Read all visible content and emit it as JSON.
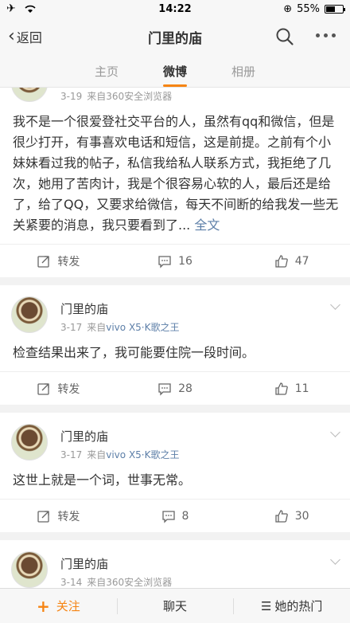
{
  "status_bar": {
    "time": "14:22",
    "battery_text": "55%",
    "battery_level": 0.55,
    "icons": [
      "airplane-icon",
      "wifi-icon",
      "lock-rotation-icon",
      "battery-icon"
    ]
  },
  "nav": {
    "back_label": "返回",
    "title": "门里的庙",
    "icons": [
      "search-icon",
      "more-icon"
    ]
  },
  "tabs": [
    {
      "label": "主页",
      "active": false
    },
    {
      "label": "微博",
      "active": true
    },
    {
      "label": "相册",
      "active": false
    }
  ],
  "accent_color": "#f68413",
  "link_color": "#5d7fa8",
  "posts": [
    {
      "author": "",
      "date": "3-19",
      "source_prefix": "来自",
      "source": "360安全浏览器",
      "text": "我不是一个很爱登社交平台的人，虽然有qq和微信，但是很少打开，有事喜欢电话和短信，这是前提。之前有个小妹妹看过我的帖子，私信我给私人联系方式，我拒绝了几次，她用了苦肉计，我是个很容易心软的人，最后还是给了，给了QQ，又要求给微信，每天不间断的给我发一些无关紧要的消息，我只要看到了... ",
      "full_text_link": "全文",
      "repost_label": "转发",
      "comments": "16",
      "likes": "47"
    },
    {
      "author": "门里的庙",
      "date": "3-17",
      "source_prefix": "来自",
      "source": "vivo X5·K歌之王",
      "text": "检查结果出来了，我可能要住院一段时间。",
      "repost_label": "转发",
      "comments": "28",
      "likes": "11"
    },
    {
      "author": "门里的庙",
      "date": "3-17",
      "source_prefix": "来自",
      "source": "vivo X5·K歌之王",
      "text": "这世上就是一个词，世事无常。",
      "repost_label": "转发",
      "comments": "8",
      "likes": "30"
    },
    {
      "author": "门里的庙",
      "date": "3-14",
      "source_prefix": "来自",
      "source": "360安全浏览器",
      "text": ""
    }
  ],
  "bottom_bar": {
    "follow": "关注",
    "chat": "聊天",
    "hot": "她的热门"
  }
}
